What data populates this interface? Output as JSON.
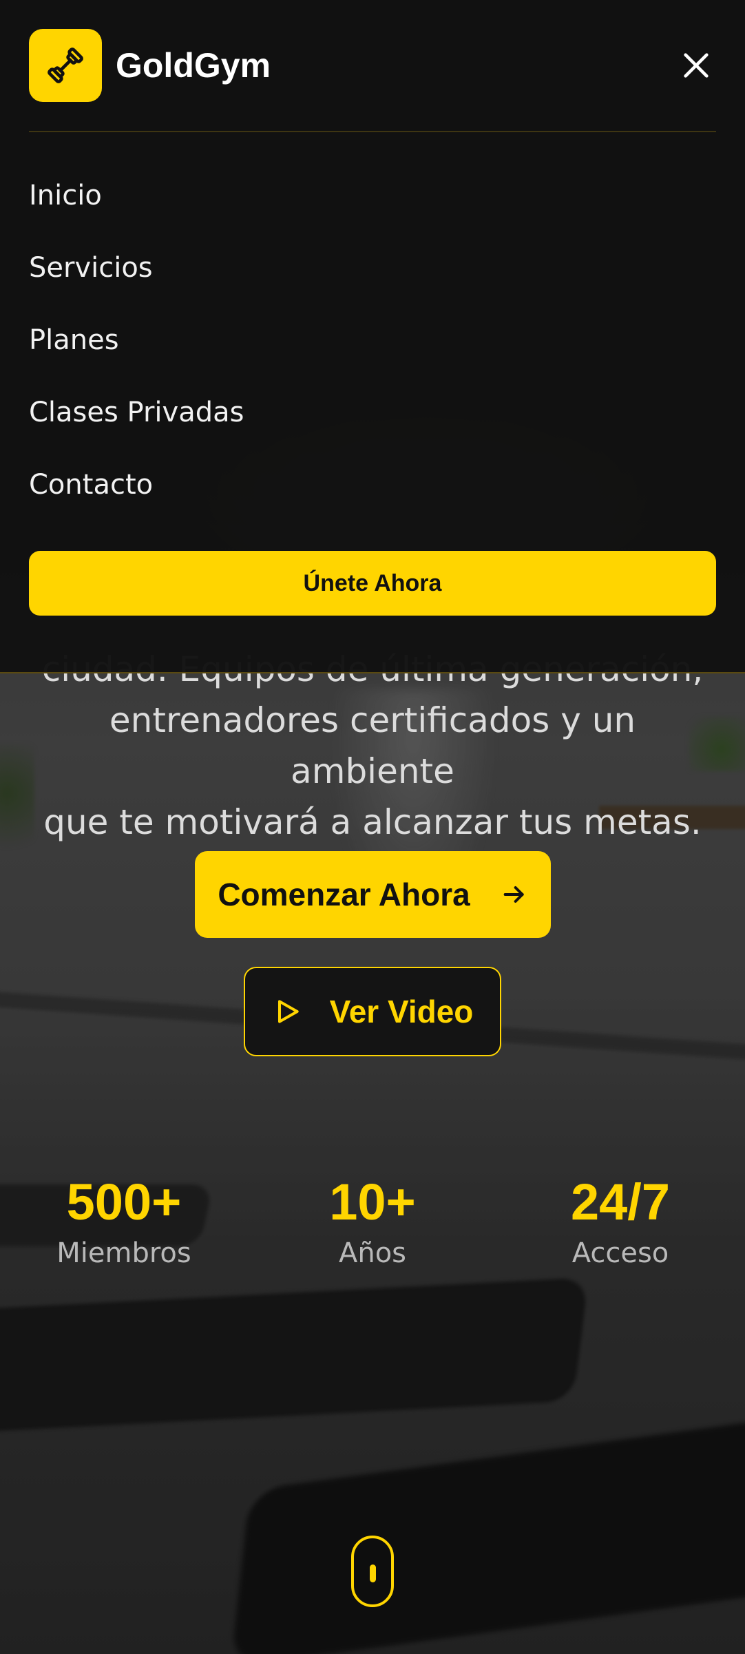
{
  "brand": {
    "name": "GoldGym",
    "logo_icon": "dumbbell-icon",
    "accent_color": "#ffd500"
  },
  "menu": {
    "close_icon": "close-icon",
    "items": [
      {
        "label": "Inicio"
      },
      {
        "label": "Servicios"
      },
      {
        "label": "Planes"
      },
      {
        "label": "Clases Privadas"
      },
      {
        "label": "Contacto"
      }
    ],
    "cta_label": "Únete Ahora"
  },
  "hero": {
    "description_partial_line": "ciudad. Equipos de última generación,",
    "description_lines": [
      "entrenadores certificados y un ambiente",
      "que te motivará a alcanzar tus metas."
    ],
    "primary_button": {
      "label": "Comenzar Ahora",
      "icon": "arrow-right-icon"
    },
    "secondary_button": {
      "label": "Ver Video",
      "icon": "play-icon"
    }
  },
  "stats": [
    {
      "value": "500+",
      "label": "Miembros"
    },
    {
      "value": "10+",
      "label": "Años"
    },
    {
      "value": "24/7",
      "label": "Acceso"
    }
  ],
  "scroll_indicator_icon": "mouse-scroll-icon"
}
